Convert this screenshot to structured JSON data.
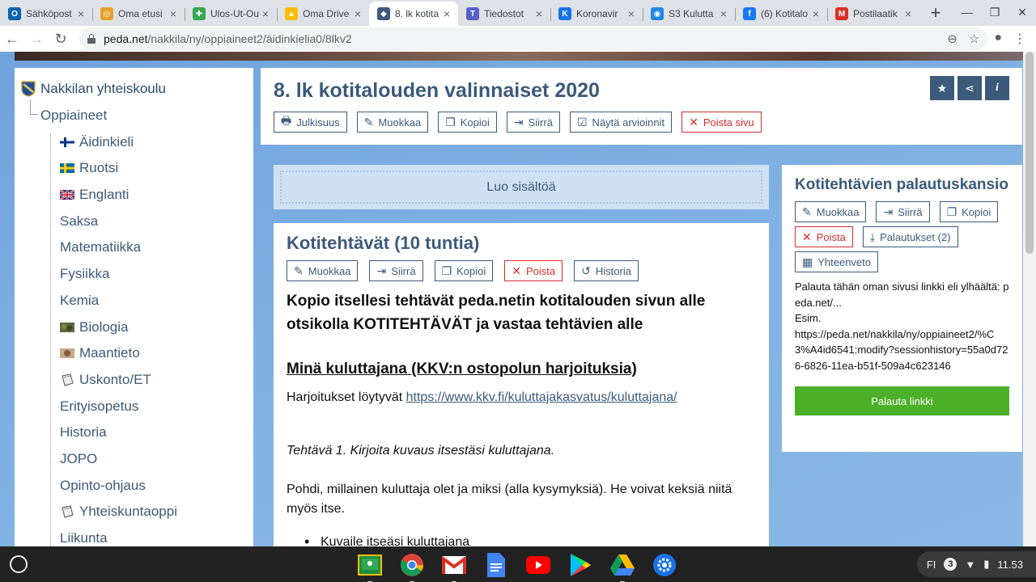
{
  "browser": {
    "tabs": [
      {
        "title": "Sähköpost",
        "icon": "outlook-icon",
        "color": "#0a64ad",
        "glyph": "O"
      },
      {
        "title": "Oma etusi",
        "icon": "chrome-icon",
        "color": "#e8a02b",
        "glyph": "◎"
      },
      {
        "title": "Ulos-Ut-Ou",
        "icon": "sheet-icon",
        "color": "#34a853",
        "glyph": "✚"
      },
      {
        "title": "Oma Drive",
        "icon": "drive-icon",
        "color": "#fbbc04",
        "glyph": "▲"
      },
      {
        "title": "8. lk kotita",
        "icon": "peda-icon",
        "color": "#3c5a7a",
        "glyph": "◆"
      },
      {
        "title": "Tiedostot",
        "icon": "teams-icon",
        "color": "#5b5fc7",
        "glyph": "T"
      },
      {
        "title": "Koronavir",
        "icon": "kkv-icon",
        "color": "#1a73e8",
        "glyph": "K"
      },
      {
        "title": "S3 Kulutta",
        "icon": "globe-icon",
        "color": "#1e88e5",
        "glyph": "◉"
      },
      {
        "title": "(6) Kotitalo",
        "icon": "facebook-icon",
        "color": "#1877f2",
        "glyph": "f"
      },
      {
        "title": "Postilaatik",
        "icon": "gmail-icon",
        "color": "#d93025",
        "glyph": "M"
      }
    ],
    "active_tab": 4,
    "url_host": "peda.net",
    "url_path": "/nakkila/ny/oppiaineet2/äidinkielia0/8lkv2"
  },
  "sidebar": {
    "root": "Nakkilan yhteiskoulu",
    "parent": "Oppiaineet",
    "items": [
      {
        "label": "Äidinkieli",
        "flag": "fi"
      },
      {
        "label": "Ruotsi",
        "flag": "se"
      },
      {
        "label": "Englanti",
        "flag": "gb"
      },
      {
        "label": "Saksa",
        "flag": ""
      },
      {
        "label": "Matematiikka",
        "flag": ""
      },
      {
        "label": "Fysiikka",
        "flag": ""
      },
      {
        "label": "Kemia",
        "flag": ""
      },
      {
        "label": "Biologia",
        "flag": "bio"
      },
      {
        "label": "Maantieto",
        "flag": "geo"
      },
      {
        "label": "Uskonto/ET",
        "flag": "book"
      },
      {
        "label": "Erityisopetus",
        "flag": ""
      },
      {
        "label": "Historia",
        "flag": ""
      },
      {
        "label": "JOPO",
        "flag": ""
      },
      {
        "label": "Opinto-ohjaus",
        "flag": ""
      },
      {
        "label": "Yhteiskuntaoppi",
        "flag": "book"
      },
      {
        "label": "Liikunta",
        "flag": ""
      }
    ]
  },
  "header": {
    "title": "8. lk kotitalouden valinnaiset 2020",
    "buttons": {
      "publicity": "Julkisuus",
      "edit": "Muokkaa",
      "copy": "Kopioi",
      "move": "Siirrä",
      "show_grades": "Näytä arvioinnit",
      "delete_page": "Poista sivu"
    }
  },
  "create_content": "Luo sisältöä",
  "content": {
    "title": "Kotitehtävät (10 tuntia)",
    "buttons": {
      "edit": "Muokkaa",
      "move": "Siirrä",
      "copy": "Kopioi",
      "delete": "Poista",
      "history": "Historia"
    },
    "lead": "Kopio itsellesi tehtävät peda.netin kotitalouden sivun alle otsikolla KOTITEHTÄVÄT ja vastaa tehtävien alle",
    "section_heading": "Minä kuluttajana (KKV:n ostopolun harjoituksia)",
    "exercises_prefix": "Harjoitukset löytyvät ",
    "exercises_link": "https://www.kkv.fi/kuluttajakasvatus/kuluttajana/",
    "task1": "Tehtävä 1. Kirjoita kuvaus itsestäsi kuluttajana.",
    "task1_desc": "Pohdi, millainen kuluttaja olet ja miksi (alla kysymyksiä). He voivat keksiä niitä myös itse.",
    "bullet1": "Kuvaile itseäsi kuluttajana"
  },
  "right_card": {
    "title": "Kotitehtävien palautuskansio",
    "buttons": {
      "edit": "Muokkaa",
      "move": "Siirrä",
      "copy": "Kopioi",
      "delete": "Poista",
      "submissions": "Palautukset (2)",
      "summary": "Yhteenveto"
    },
    "text_line1": "Palauta tähän oman sivusi linkki eli ylhäältä: peda.net/...",
    "text_line2": "Esim.",
    "text_line3": "https://peda.net/nakkila/ny/oppiaineet2/%C3%A4id6541:modify?sessionhistory=55a0d726-6826-11ea-b51f-509a4c623146",
    "submit": "Palauta linkki"
  },
  "shelf": {
    "language": "FI",
    "notifications": "3",
    "time": "11.53"
  },
  "colors": {
    "accent": "#3c5a7a",
    "danger": "#d32f2f",
    "submit": "#4caf28"
  }
}
